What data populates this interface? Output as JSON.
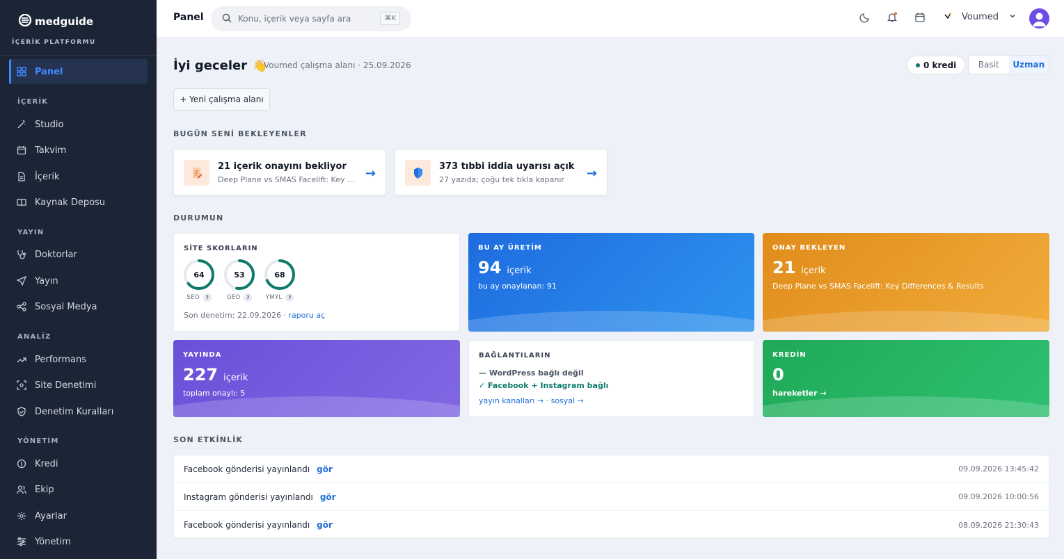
{
  "brand": {
    "name": "medguide",
    "subtitle": "İÇERİK PLATFORMU"
  },
  "sidebar": {
    "active": {
      "label": "Panel",
      "icon": "grid-icon"
    },
    "sections": [
      {
        "title": "İÇERİK",
        "items": [
          {
            "label": "Studio",
            "icon": "magic-wand-icon"
          },
          {
            "label": "Takvim",
            "icon": "calendar-icon"
          },
          {
            "label": "İçerik",
            "icon": "document-icon"
          },
          {
            "label": "Kaynak Deposu",
            "icon": "book-open-icon"
          }
        ]
      },
      {
        "title": "YAYIN",
        "items": [
          {
            "label": "Doktorlar",
            "icon": "stethoscope-icon"
          },
          {
            "label": "Yayın",
            "icon": "send-icon"
          },
          {
            "label": "Sosyal Medya",
            "icon": "share-icon"
          }
        ]
      },
      {
        "title": "ANALİZ",
        "items": [
          {
            "label": "Performans",
            "icon": "trend-up-icon"
          },
          {
            "label": "Site Denetimi",
            "icon": "scan-icon"
          },
          {
            "label": "Denetim Kuralları",
            "icon": "shield-check-icon"
          }
        ]
      },
      {
        "title": "YÖNETİM",
        "items": [
          {
            "label": "Kredi",
            "icon": "coin-icon"
          },
          {
            "label": "Ekip",
            "icon": "users-icon"
          },
          {
            "label": "Ayarlar",
            "icon": "gear-icon"
          },
          {
            "label": "Yönetim",
            "icon": "sliders-icon"
          }
        ]
      }
    ]
  },
  "topbar": {
    "title": "Panel",
    "search_placeholder": "Konu, içerik veya sayfa ara",
    "shortcut": "⌘K",
    "user": "Voumed"
  },
  "header": {
    "greeting": "İyi geceler",
    "emoji": "👋",
    "subtitle": "Voumed çalışma alanı · 25.09.2026",
    "kredi": "0 kredi",
    "modes": [
      "Basit",
      "Uzman"
    ],
    "active_mode": "Uzman",
    "new_workspace": "+ Yeni çalışma alanı"
  },
  "waiting": {
    "title": "BUGÜN SENİ BEKLEYENLER",
    "cards": [
      {
        "title": "21 içerik onayını bekliyor",
        "subtitle": "Deep Plane vs SMAS Facelift: Key Differences & Results",
        "icon": "edit-document-icon"
      },
      {
        "title": "373 tıbbi iddia uyarısı açık",
        "subtitle": "27 yazıda; çoğu tek tıkla kapanır",
        "icon": "shield-icon"
      }
    ],
    "arrow": "→"
  },
  "status": {
    "title": "DURUMUN",
    "site_scores": {
      "label": "SİTE SKORLARIN",
      "scores": [
        {
          "name": "SEO",
          "value": 64
        },
        {
          "name": "GEO",
          "value": 53
        },
        {
          "name": "YMYL",
          "value": 68
        }
      ],
      "help": "?",
      "last_audit": "Son denetim: 22.09.2026 ·",
      "report_link": "raporu aç"
    },
    "production": {
      "label": "BU AY ÜRETİM",
      "value": "94",
      "unit": "içerik",
      "sub": "bu ay onaylanan: 91",
      "color": "#2383ea"
    },
    "pending": {
      "label": "ONAY BEKLEYEN",
      "value": "21",
      "unit": "içerik",
      "sub": "Deep Plane vs SMAS Facelift: Key Differences & Results",
      "color": "#e79a22"
    },
    "published": {
      "label": "YAYINDA",
      "value": "227",
      "unit": "içerik",
      "sub": "toplam onaylı: 5",
      "color": "#7358dc"
    },
    "connections": {
      "label": "BAĞLANTILARIN",
      "wordpress": "— WordPress bağlı değil",
      "social": "✓ Facebook + Instagram bağlı",
      "link1": "yayın kanalları →",
      "sep": "·",
      "link2": "sosyal →"
    },
    "credit": {
      "label": "KREDİN",
      "value": "0",
      "link": "hareketler →",
      "color": "#22b463"
    }
  },
  "activity": {
    "title": "SON ETKİNLİK",
    "link_label": "gör",
    "rows": [
      {
        "text": "Facebook gönderisi yayınlandı",
        "time": "09.09.2026 13:45:42"
      },
      {
        "text": "Instagram gönderisi yayınlandı",
        "time": "09.09.2026 10:00:56"
      },
      {
        "text": "Facebook gönderisi yayınlandı",
        "time": "08.09.2026 21:30:43"
      }
    ]
  }
}
